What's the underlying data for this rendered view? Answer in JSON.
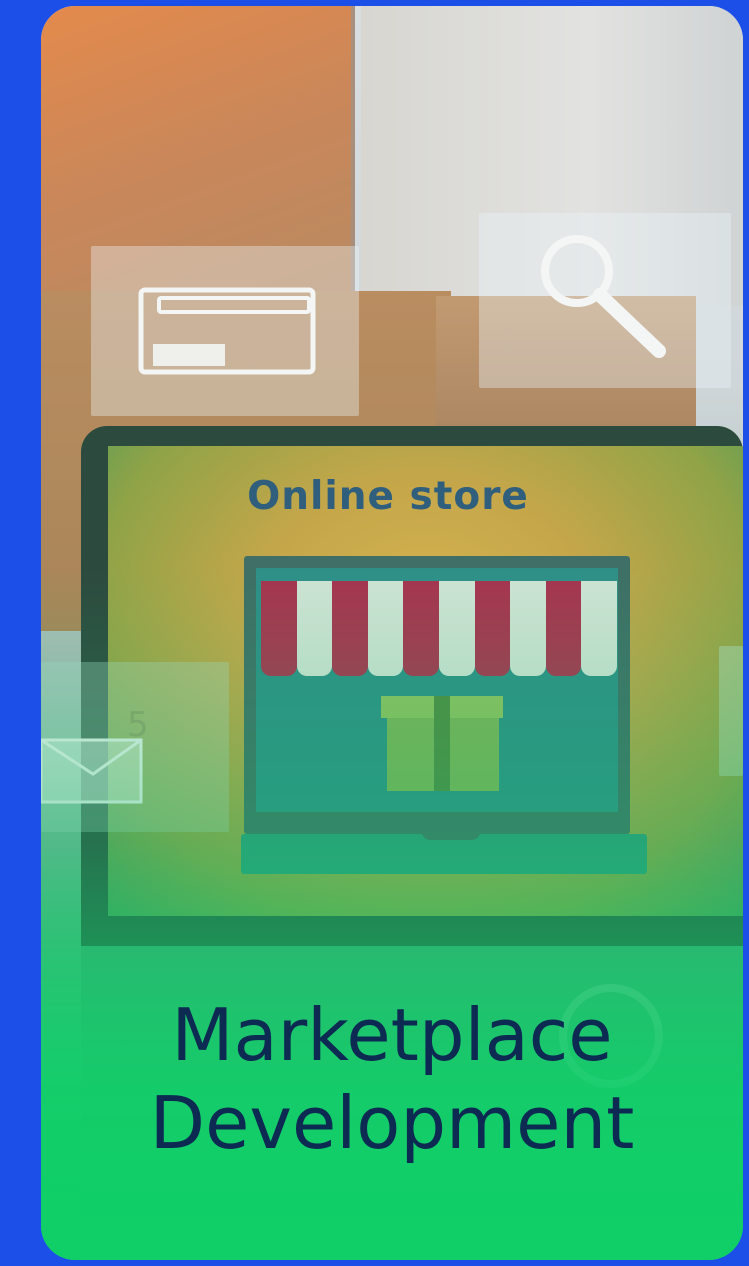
{
  "screen": {
    "title": "Online store",
    "mail_count": "5"
  },
  "card": {
    "headline_line1": "Marketplace",
    "headline_line2": "Development"
  },
  "colors": {
    "page_background": "#1c4fe8",
    "headline": "#0c2a52",
    "green_accent": "#10cf66",
    "awning_red": "#a7344f",
    "awning_light": "#cfe3d4"
  },
  "icons": [
    "browser-window-icon",
    "search-icon",
    "mail-icon",
    "storefront-icon",
    "gift-box-icon",
    "refresh-icon"
  ]
}
